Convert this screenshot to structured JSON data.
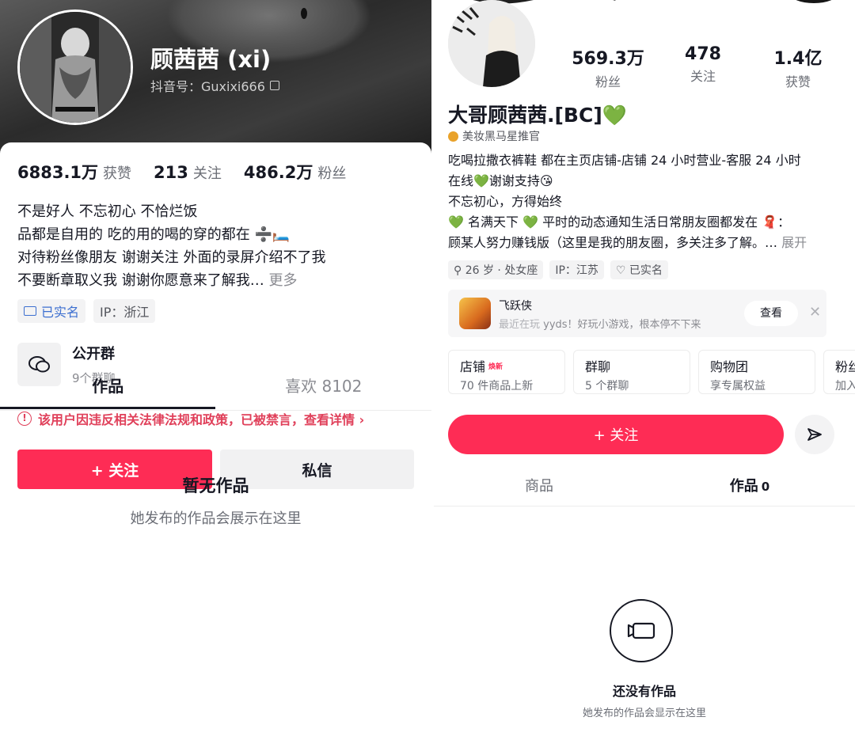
{
  "left": {
    "nickname": "顾茜茜 (xi)",
    "douyin_id": "抖音号：Guxixi666",
    "stats": [
      {
        "value": "6883.1万",
        "label": "获赞"
      },
      {
        "value": "213",
        "label": "关注"
      },
      {
        "value": "486.2万",
        "label": "粉丝"
      }
    ],
    "bio_lines": [
      "不是好人 不忘初心 不恰烂饭",
      "品都是自用的 吃的用的喝的穿的都在 ➗🛏️",
      " 对待粉丝像朋友 谢谢关注           外面的录屏介绍不了我",
      "不要断章取义我 谢谢你愿意来了解我…"
    ],
    "bio_more": "更多",
    "tags": [
      "已实名",
      "IP：浙江"
    ],
    "group": {
      "name": "公开群",
      "sub": "9个群聊"
    },
    "warning": "该用户因违反相关法律法规和政策，已被禁言，查看详情 ›",
    "follow_label": "+ 关注",
    "message_label": "私信",
    "tabs": [
      "作品",
      "喜欢 8102"
    ],
    "empty_title": "暂无作品",
    "empty_sub": "她发布的作品会展示在这里"
  },
  "right": {
    "stats": [
      {
        "value": "569.3万",
        "label": "粉丝"
      },
      {
        "value": "478",
        "label": "关注"
      },
      {
        "value": "1.4亿",
        "label": "获赞"
      }
    ],
    "nickname": "大哥顾茜茜.[BC]💚",
    "badge": "美妆黑马星推官",
    "bio_lines": [
      "吃喝拉撒衣裤鞋 都在主页店铺-店铺 24 小时营业-客服 24 小时",
      "在线💚谢谢支持😘",
      "不忘初心，方得始终",
      "💚 名满天下 💚 平时的动态通知生活日常朋友圈都发在 🧣：",
      "顾某人努力赚钱版（这里是我的朋友圈，多关注多了解。…"
    ],
    "bio_more": "展开",
    "tags": [
      "⚲ 26 岁 · 处女座",
      "IP：江苏",
      "♡ 已实名"
    ],
    "game": {
      "name": "飞跃侠",
      "playing": "最近在玩",
      "desc": " yyds！好玩小游戏，根本停不下来",
      "button": "查看",
      "close": "✕"
    },
    "shop": [
      {
        "title": "店铺",
        "new": "焕新",
        "sub": "70 件商品上新"
      },
      {
        "title": "群聊",
        "new": "",
        "sub": "5 个群聊"
      },
      {
        "title": "购物团",
        "new": "",
        "sub": "享专属权益"
      },
      {
        "title": "粉丝",
        "new": "",
        "sub": "加入"
      }
    ],
    "follow_label": "+ 关注",
    "tabs": [
      {
        "label": "商品",
        "count": ""
      },
      {
        "label": "作品",
        "count": "0"
      }
    ],
    "empty_title": "还没有作品",
    "empty_sub": "她发布的作品会显示在这里"
  },
  "colors": {
    "brand_red": "#fe2c55",
    "warning_red": "#e0405a",
    "verified_blue": "#3c6fd0"
  }
}
